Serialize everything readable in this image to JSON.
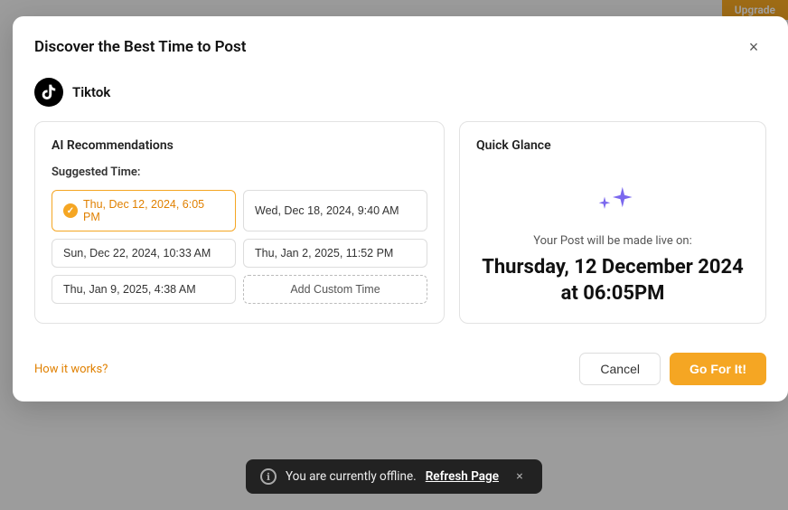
{
  "topbar": {
    "upgrade_label": "Upgrade"
  },
  "modal": {
    "title": "Discover the Best Time to Post",
    "close_label": "×",
    "platform": {
      "name": "Tiktok",
      "icon_label": "T"
    },
    "ai_panel": {
      "title": "AI Recommendations",
      "suggested_label": "Suggested Time:",
      "times": [
        {
          "id": "t1",
          "label": "Thu, Dec 12, 2024, 6:05 PM",
          "selected": true
        },
        {
          "id": "t2",
          "label": "Wed, Dec 18, 2024, 9:40 AM",
          "selected": false
        },
        {
          "id": "t3",
          "label": "Sun, Dec 22, 2024, 10:33 AM",
          "selected": false
        },
        {
          "id": "t4",
          "label": "Thu, Jan 2, 2025, 11:52 PM",
          "selected": false
        },
        {
          "id": "t5",
          "label": "Thu, Jan 9, 2025, 4:38 AM",
          "selected": false
        }
      ],
      "add_custom_label": "Add Custom Time"
    },
    "quick_panel": {
      "title": "Quick Glance",
      "live_label": "Your Post will be made live on:",
      "live_date_line1": "Thursday, 12 December 2024",
      "live_date_line2": "at 06:05PM"
    },
    "footer": {
      "how_it_works_label": "How it works?",
      "cancel_label": "Cancel",
      "go_label": "Go For It!"
    }
  },
  "offline_banner": {
    "info_icon": "ℹ",
    "message": "You are currently offline.",
    "refresh_label": "Refresh Page",
    "close_label": "×"
  }
}
